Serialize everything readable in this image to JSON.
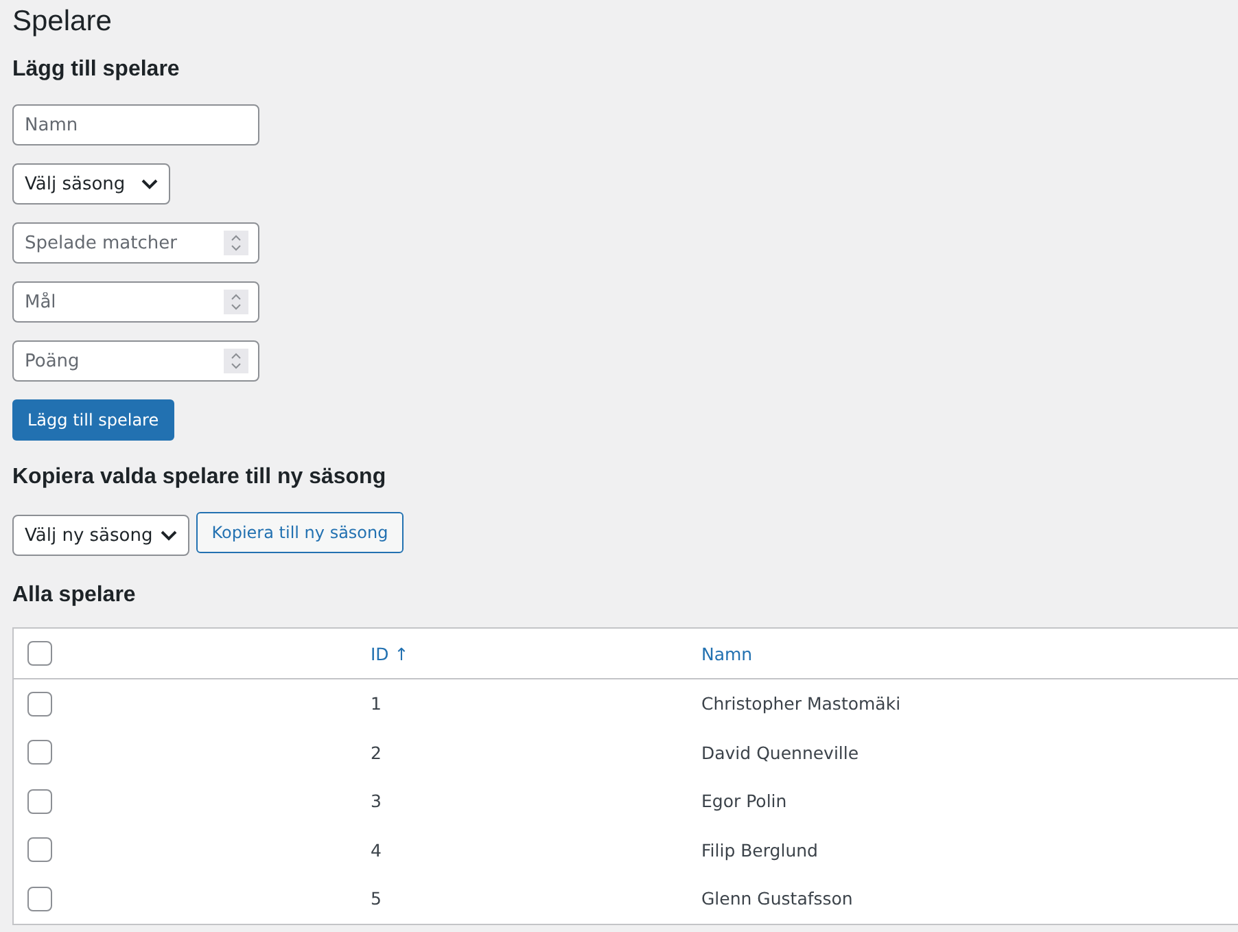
{
  "page_title": "Spelare",
  "add_section": {
    "heading": "Lägg till spelare",
    "fields": [
      {
        "kind": "text",
        "placeholder": "Namn"
      },
      {
        "kind": "select",
        "value": "Välj säsong"
      },
      {
        "kind": "number",
        "placeholder": "Spelade matcher"
      },
      {
        "kind": "number",
        "placeholder": "Mål"
      },
      {
        "kind": "number",
        "placeholder": "Poäng"
      }
    ],
    "button": "Lägg till spelare"
  },
  "copy_section": {
    "heading": "Kopiera valda spelare till ny säsong",
    "select": "Välj ny säsong",
    "button": "Kopiera till ny säsong"
  },
  "table": {
    "heading": "Alla spelare",
    "select_all_checked": false,
    "columns": [
      {
        "label": "ID",
        "sort_indicator": "↑"
      },
      {
        "label": "Namn"
      }
    ],
    "rows": [
      {
        "checked": false,
        "id": "1",
        "name": "Christopher Mastomäki"
      },
      {
        "checked": false,
        "id": "2",
        "name": "David Quenneville"
      },
      {
        "checked": false,
        "id": "3",
        "name": "Egor Polin"
      },
      {
        "checked": false,
        "id": "4",
        "name": "Filip Berglund"
      },
      {
        "checked": false,
        "id": "5",
        "name": "Glenn Gustafsson"
      }
    ]
  }
}
